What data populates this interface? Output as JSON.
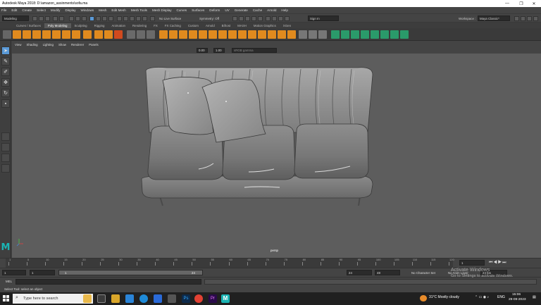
{
  "window": {
    "title": "Autodesk Maya 2018: D:\\amazon_assinments\\sofa.ma",
    "minimize": "—",
    "maximize": "❐",
    "close": "✕"
  },
  "menu": [
    "File",
    "Edit",
    "Create",
    "Select",
    "Modify",
    "Display",
    "Windows",
    "Mesh",
    "Edit Mesh",
    "Mesh Tools",
    "Mesh Display",
    "Curves",
    "Surfaces",
    "Deform",
    "UV",
    "Generate",
    "Cache",
    "Arnold",
    "Help"
  ],
  "status": {
    "mode": "Modeling",
    "live_surface": "No Live Surface",
    "symmetry": "Symmetry: Off",
    "sign_in": "Sign In",
    "workspace_label": "Workspace :",
    "workspace": "Maya Classic*"
  },
  "shelf_tabs": [
    "Curves / Surfaces",
    "Poly Modeling",
    "Sculpting",
    "Rigging",
    "Animation",
    "Rendering",
    "FX",
    "FX Caching",
    "Custom",
    "Arnold",
    "Bifrost",
    "MASH",
    "Motion Graphics",
    "XGen"
  ],
  "active_shelf_tab": 1,
  "panel_menu": [
    "View",
    "Shading",
    "Lighting",
    "Show",
    "Renderer",
    "Panels"
  ],
  "panel_fields": {
    "exposure": "0.00",
    "gamma": "1.00",
    "color_space": "sRGB gamma"
  },
  "camera": "persp",
  "timeline": {
    "ticks": [
      "1",
      "5",
      "10",
      "15",
      "20",
      "25",
      "30",
      "35",
      "40",
      "45",
      "50",
      "55",
      "60",
      "65",
      "70",
      "75",
      "80",
      "85",
      "90",
      "95",
      "100",
      "105",
      "110",
      "115",
      "120"
    ],
    "current": "1"
  },
  "range": {
    "start": "1",
    "start2": "1",
    "slider_start": "1",
    "slider_end": "24",
    "end": "24",
    "end2": "48",
    "character_set": "No Character Set",
    "anim_layer": "No Anim Layer",
    "fps": "24 fps"
  },
  "cmd": {
    "label": "MEL"
  },
  "help": "Select Tool: select an object",
  "taskbar": {
    "search": "Type here to search",
    "weather": "31°C  Mostly cloudy",
    "lang": "ENG",
    "time": "15:06",
    "date": "29-09-2023"
  },
  "watermark": {
    "line1": "Activate Windows",
    "line2": "Go to Settings to activate Windows."
  },
  "colors": {
    "viewport": "#5d5d5d",
    "shelf_orange": "#e08a1e",
    "shelf_green": "#2a9a6a",
    "maya_logo": "#1ab4b4",
    "selected": "#5a9ad8"
  },
  "icons": [
    "select-arrow-icon",
    "lasso-icon",
    "paint-select-icon",
    "move-icon",
    "rotate-icon",
    "scale-icon",
    "maya-logo-icon",
    "windows-start-icon",
    "search-icon"
  ]
}
